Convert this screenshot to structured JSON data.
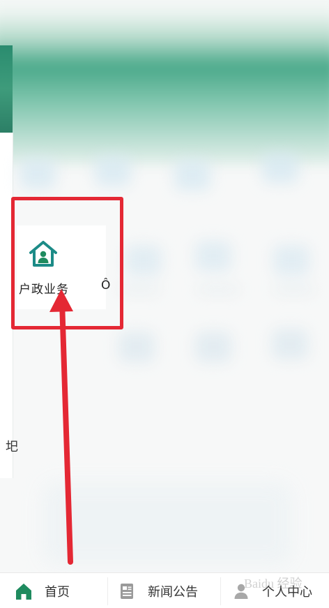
{
  "colors": {
    "theme_green": "#1f8b5f",
    "teal": "#1c8b87",
    "highlight_red": "#e42834",
    "text_dark": "#222222"
  },
  "highlighted_tile": {
    "label": "户政业务",
    "partial_neighbor_label": "Ô",
    "icon": "house-user-icon"
  },
  "left_edge_partial_char": "圯",
  "bottom_nav": [
    {
      "label": "首页",
      "icon": "home-icon",
      "active": true
    },
    {
      "label": "新闻公告",
      "icon": "news-icon",
      "active": false
    },
    {
      "label": "个人中心",
      "icon": "user-icon",
      "active": false
    }
  ],
  "watermark": "Baidu 经验"
}
